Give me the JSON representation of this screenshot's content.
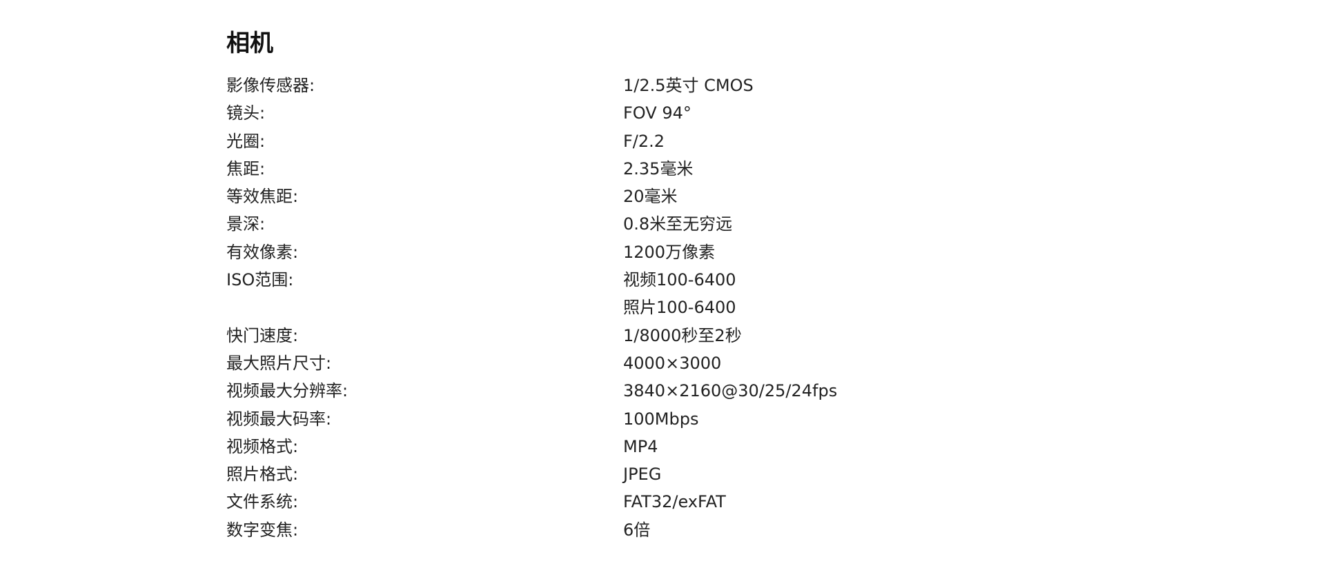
{
  "section": {
    "title": "相机"
  },
  "specs": [
    {
      "label": "影像传感器:",
      "values": [
        "1/2.5英寸 CMOS"
      ]
    },
    {
      "label": "镜头:",
      "values": [
        "FOV 94°"
      ]
    },
    {
      "label": "光圈:",
      "values": [
        "F/2.2"
      ]
    },
    {
      "label": "焦距:",
      "values": [
        "2.35毫米"
      ]
    },
    {
      "label": "等效焦距:",
      "values": [
        "20毫米"
      ]
    },
    {
      "label": "景深:",
      "values": [
        "0.8米至无穷远"
      ]
    },
    {
      "label": "有效像素:",
      "values": [
        "1200万像素"
      ]
    },
    {
      "label": "ISO范围:",
      "values": [
        "视频100-6400",
        "照片100-6400"
      ]
    },
    {
      "label": "快门速度:",
      "values": [
        "1/8000秒至2秒"
      ]
    },
    {
      "label": "最大照片尺寸:",
      "values": [
        "4000×3000"
      ]
    },
    {
      "label": "视频最大分辨率:",
      "values": [
        "3840×2160@30/25/24fps"
      ]
    },
    {
      "label": "视频最大码率:",
      "values": [
        "100Mbps"
      ]
    },
    {
      "label": "视频格式:",
      "values": [
        "MP4"
      ]
    },
    {
      "label": "照片格式:",
      "values": [
        "JPEG"
      ]
    },
    {
      "label": "文件系统:",
      "values": [
        "FAT32/exFAT"
      ]
    },
    {
      "label": "数字变焦:",
      "values": [
        "6倍"
      ]
    }
  ]
}
